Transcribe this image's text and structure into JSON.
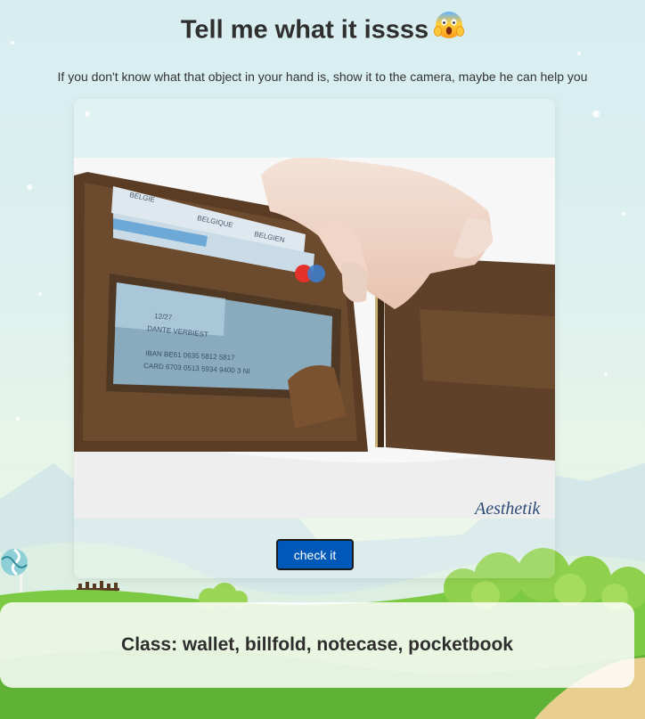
{
  "page": {
    "title": "Tell me what it issss",
    "subtitle": "If you don't know what that object in your hand is, show it to the camera, maybe he can help you"
  },
  "camera": {
    "card_lines": [
      "BELGIE",
      "BELGIQUE",
      "BELGIEN",
      "12/27",
      "DANTE VERBIEST",
      "IBAN BE61 0635 5812 5817",
      "CARD 6703 0513 5934 9400 3 NI"
    ],
    "shirt_text": "Aesthetik"
  },
  "button": {
    "label": "check it"
  },
  "result": {
    "text": "Class: wallet, billfold, notecase, pocketbook"
  },
  "colors": {
    "button_bg": "#0058b8",
    "accent_grass": "#6cc43a"
  }
}
